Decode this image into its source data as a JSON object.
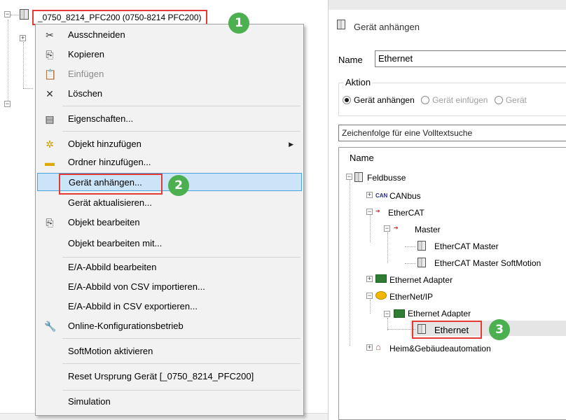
{
  "project_tree": {
    "root_label": "_0750_8214_PFC200 (0750-8214 PFC200)"
  },
  "context_menu": {
    "items": [
      {
        "label": "Ausschneiden",
        "icon": "scissors-icon",
        "enabled": true
      },
      {
        "label": "Kopieren",
        "icon": "copy-icon",
        "enabled": true
      },
      {
        "label": "Einfügen",
        "icon": "paste-icon",
        "enabled": false
      },
      {
        "label": "Löschen",
        "icon": "delete-icon",
        "enabled": true
      },
      {
        "label": "Eigenschaften...",
        "icon": "properties-icon",
        "enabled": true
      },
      {
        "label": "Objekt hinzufügen",
        "icon": "add-object-icon",
        "enabled": true,
        "submenu": true
      },
      {
        "label": "Ordner hinzufügen...",
        "icon": "folder-icon",
        "enabled": true
      },
      {
        "label": "Gerät anhängen...",
        "icon": "",
        "enabled": true,
        "highlighted": true
      },
      {
        "label": "Gerät aktualisieren...",
        "icon": "",
        "enabled": true
      },
      {
        "label": "Objekt bearbeiten",
        "icon": "edit-object-icon",
        "enabled": true
      },
      {
        "label": "Objekt bearbeiten mit...",
        "icon": "",
        "enabled": true
      },
      {
        "label": "E/A-Abbild bearbeiten",
        "icon": "",
        "enabled": true
      },
      {
        "label": "E/A-Abbild von CSV importieren...",
        "icon": "",
        "enabled": true
      },
      {
        "label": "E/A-Abbild in CSV exportieren...",
        "icon": "",
        "enabled": true
      },
      {
        "label": "Online-Konfigurationsbetrieb",
        "icon": "online-config-icon",
        "enabled": true
      },
      {
        "label": "SoftMotion aktivieren",
        "icon": "",
        "enabled": true
      },
      {
        "label": "Reset Ursprung Gerät [_0750_8214_PFC200]",
        "icon": "",
        "enabled": true
      },
      {
        "label": "Simulation",
        "icon": "",
        "enabled": true
      }
    ]
  },
  "callouts": [
    "1",
    "2",
    "3"
  ],
  "dialog": {
    "title": "Gerät anhängen",
    "name_label": "Name",
    "name_value": "Ethernet",
    "action_group_label": "Aktion",
    "radios": [
      {
        "label": "Gerät anhängen",
        "selected": true
      },
      {
        "label": "Gerät einfügen",
        "selected": false
      },
      {
        "label": "Gerät",
        "selected": false
      }
    ],
    "search_placeholder": "Zeichenfolge für eine Volltextsuche",
    "tree_header": "Name",
    "tree": [
      {
        "label": "Feldbusse",
        "depth": 0
      },
      {
        "label": "CANbus",
        "depth": 1,
        "prefix": "CAN"
      },
      {
        "label": "EtherCAT",
        "depth": 1
      },
      {
        "label": "Master",
        "depth": 2
      },
      {
        "label": "EtherCAT Master",
        "depth": 3
      },
      {
        "label": "EtherCAT Master SoftMotion",
        "depth": 3
      },
      {
        "label": "Ethernet Adapter",
        "depth": 1
      },
      {
        "label": "EtherNet/IP",
        "depth": 1
      },
      {
        "label": "Ethernet Adapter",
        "depth": 2
      },
      {
        "label": "Ethernet",
        "depth": 3,
        "selected": true
      },
      {
        "label": "Heim&Gebäudeautomation",
        "depth": 1
      }
    ]
  },
  "colors": {
    "callout_red": "#e53935",
    "badge_green": "#4caf50",
    "menu_highlight": "#cce4f7",
    "menu_highlight_border": "#4aa3df"
  }
}
